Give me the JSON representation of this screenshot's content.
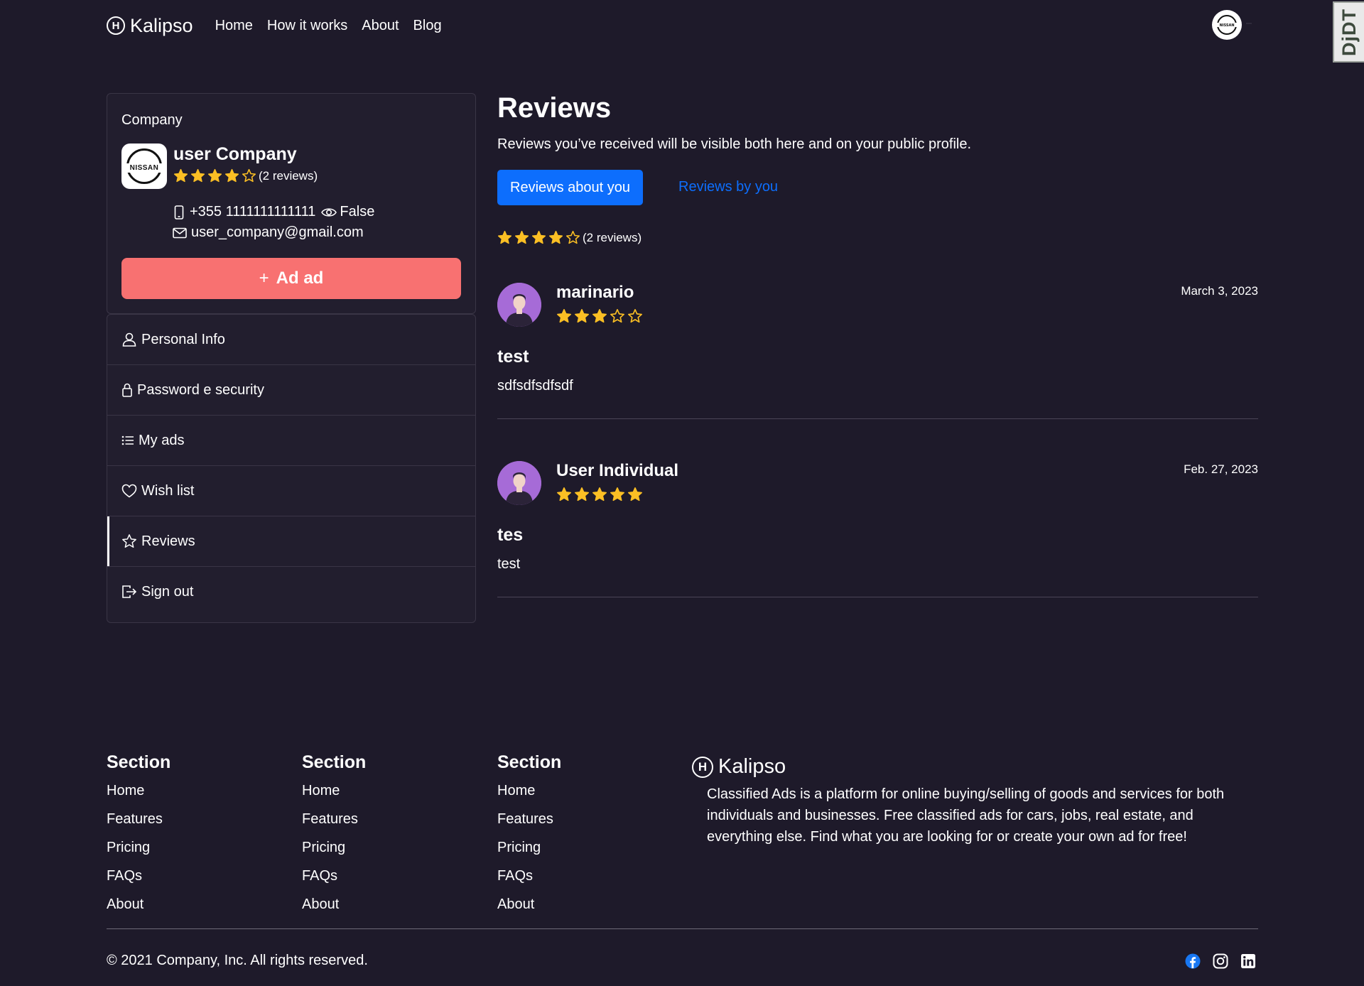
{
  "header": {
    "brand": "Kalipso",
    "brand_mark": "H",
    "nav": [
      "Home",
      "How it works",
      "About",
      "Blog"
    ]
  },
  "devtools_label": "DjDT",
  "sidebar": {
    "heading": "Company",
    "logo_text": "NISSAN",
    "company_name": "user Company",
    "rating": 4,
    "reviews_count": "(2 reviews)",
    "phone": "+355 1111111111111",
    "phone_visibility": "False",
    "email": "user_company@gmail.com",
    "ad_button": "Ad ad",
    "menu": [
      {
        "label": "Personal Info",
        "icon": "person-icon"
      },
      {
        "label": "Password e security",
        "icon": "lock-icon"
      },
      {
        "label": "My ads",
        "icon": "list-icon"
      },
      {
        "label": "Wish list",
        "icon": "heart-icon"
      },
      {
        "label": "Reviews",
        "icon": "star-icon",
        "active": true
      },
      {
        "label": "Sign out",
        "icon": "sign-out-icon"
      }
    ]
  },
  "main": {
    "title": "Reviews",
    "subtitle": "Reviews you’ve received will be visible both here and on your public profile.",
    "tab_about_you": "Reviews about you",
    "tab_by_you": "Reviews by you",
    "overall_rating": 4,
    "overall_count": "(2 reviews)",
    "reviews": [
      {
        "author": "marinario",
        "rating": 3,
        "date": "March 3, 2023",
        "title": "test",
        "body": "sdfsdfsdfsdf"
      },
      {
        "author": "User Individual",
        "rating": 5,
        "date": "Feb. 27, 2023",
        "title": "tes",
        "body": "test"
      }
    ]
  },
  "footer": {
    "columns": [
      {
        "heading": "Section",
        "links": [
          "Home",
          "Features",
          "Pricing",
          "FAQs",
          "About"
        ]
      },
      {
        "heading": "Section",
        "links": [
          "Home",
          "Features",
          "Pricing",
          "FAQs",
          "About"
        ]
      },
      {
        "heading": "Section",
        "links": [
          "Home",
          "Features",
          "Pricing",
          "FAQs",
          "About"
        ]
      }
    ],
    "brand": "Kalipso",
    "description": "Classified Ads is a platform for online buying/selling of goods and services for both individuals and businesses. Free classified ads for cars, jobs, real estate, and everything else. Find what you are looking for or create your own ad for free!",
    "copyright": "© 2021 Company, Inc. All rights reserved.",
    "social": [
      "facebook-icon",
      "instagram-icon",
      "linkedin-icon"
    ]
  },
  "colors": {
    "background": "#1e1a2a",
    "card": "#221e2e",
    "primary": "#0d6efd",
    "accent": "#f87171",
    "star": "#fbbf24",
    "avatar": "#a66bd7"
  }
}
